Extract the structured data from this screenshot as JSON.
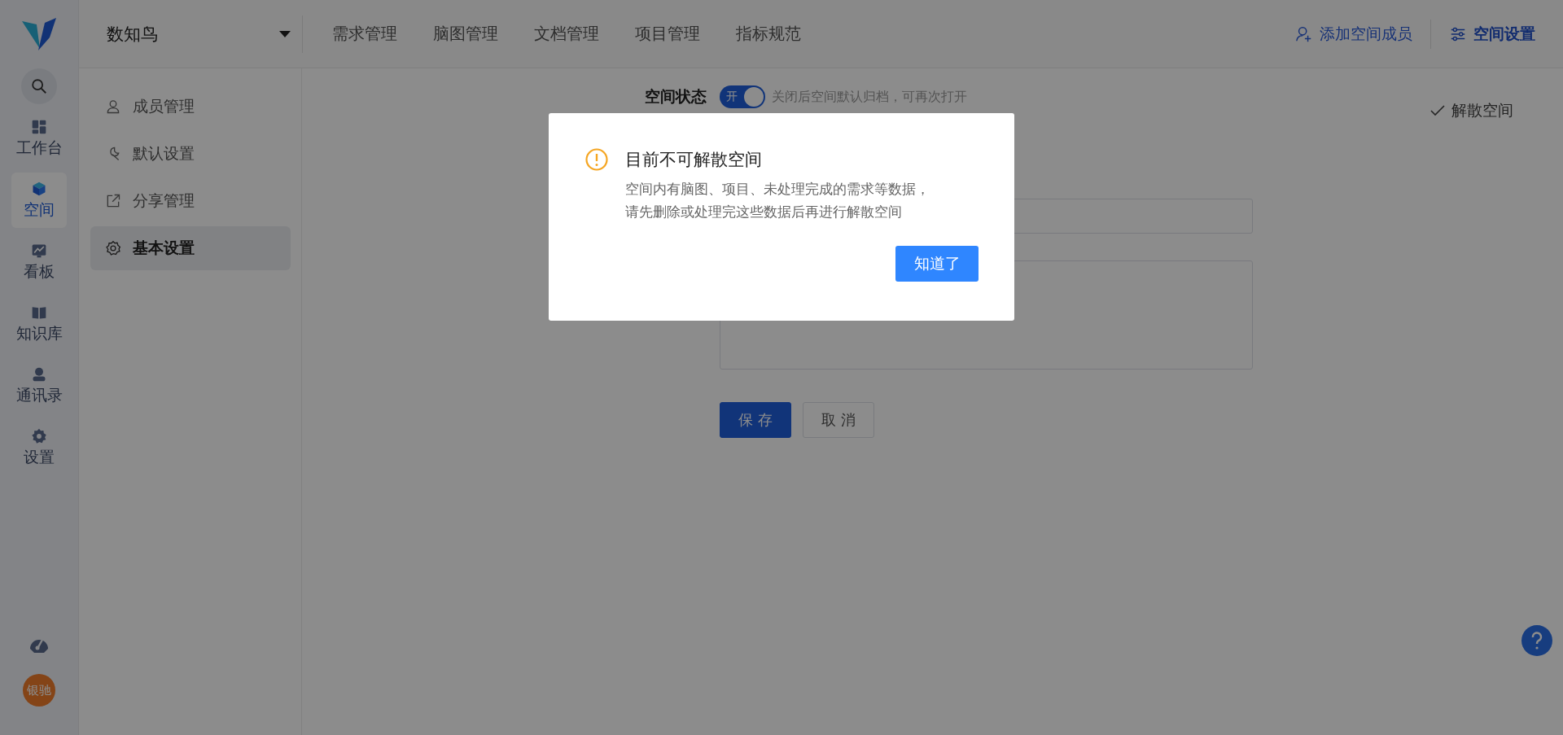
{
  "sidebar": {
    "items": [
      {
        "label": "工作台",
        "kind": "dashboard",
        "selected": false
      },
      {
        "label": "空间",
        "kind": "cube",
        "selected": true
      },
      {
        "label": "看板",
        "kind": "chart",
        "selected": false
      },
      {
        "label": "知识库",
        "kind": "book",
        "selected": false
      },
      {
        "label": "通讯录",
        "kind": "contact",
        "selected": false
      },
      {
        "label": "设置",
        "kind": "gear",
        "selected": false
      }
    ],
    "avatar": "银驰"
  },
  "header": {
    "workspace": "数知鸟",
    "nav": [
      {
        "label": "需求管理"
      },
      {
        "label": "脑图管理"
      },
      {
        "label": "文档管理"
      },
      {
        "label": "项目管理"
      },
      {
        "label": "指标规范"
      }
    ],
    "actions": [
      {
        "label": "添加空间成员",
        "kind": "add-user",
        "selected": false
      },
      {
        "label": "空间设置",
        "kind": "sliders",
        "selected": true
      }
    ]
  },
  "settings_nav": [
    {
      "label": "成员管理",
      "kind": "person",
      "selected": false
    },
    {
      "label": "默认设置",
      "kind": "wrench",
      "selected": false
    },
    {
      "label": "分享管理",
      "kind": "share",
      "selected": false
    },
    {
      "label": "基本设置",
      "kind": "gear",
      "selected": true
    }
  ],
  "form": {
    "space_status": {
      "label": "空间状态",
      "on": true,
      "switch_text": "开",
      "hint": "关闭后空间默认归档，可再次打开"
    },
    "dissolve": "解散空间",
    "buttons": [
      {
        "label": "保 存",
        "kind": "primary"
      },
      {
        "label": "取 消",
        "kind": "default"
      }
    ]
  },
  "dialog": {
    "title": "目前不可解散空间",
    "message_lines": [
      "空间内有脑图、项目、未处理完成的需求等数据，",
      "请先删除或处理完这些数据后再进行解散空间"
    ],
    "button": "知道了"
  }
}
